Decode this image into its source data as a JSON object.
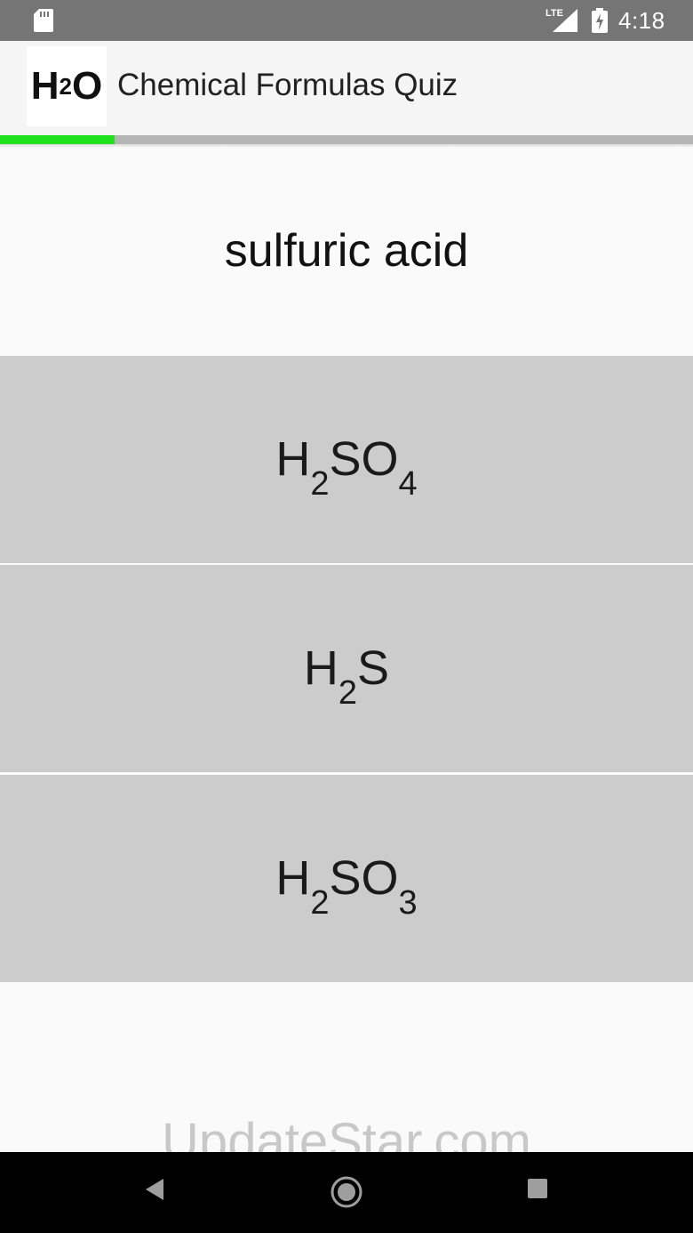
{
  "status_bar": {
    "time": "4:18",
    "network_label": "LTE",
    "icons": [
      "sd-card-icon",
      "signal-icon",
      "battery-charging-icon"
    ]
  },
  "app_bar": {
    "icon_main": "H",
    "icon_sub": "2",
    "icon_tail": "O",
    "title": "Chemical Formulas Quiz",
    "progress_fraction": 0.165,
    "progress_color": "#1ee21e"
  },
  "question": {
    "text": "sulfuric acid"
  },
  "answers": [
    {
      "parts": [
        {
          "t": "H"
        },
        {
          "s": "2"
        },
        {
          "t": "SO"
        },
        {
          "s": "4"
        }
      ]
    },
    {
      "parts": [
        {
          "t": "H"
        },
        {
          "s": "2"
        },
        {
          "t": "S"
        }
      ]
    },
    {
      "parts": [
        {
          "t": "H"
        },
        {
          "s": "2"
        },
        {
          "t": "SO"
        },
        {
          "s": "3"
        }
      ]
    }
  ],
  "answer_background": "#cccccc",
  "watermark": "UpdateStar.com",
  "nav_bar": {
    "icons": [
      "back-icon",
      "home-icon",
      "recents-icon"
    ]
  }
}
